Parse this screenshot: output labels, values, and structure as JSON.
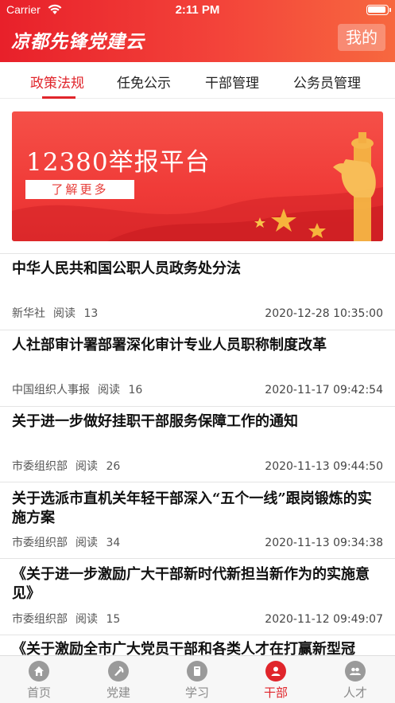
{
  "status_bar": {
    "carrier": "Carrier",
    "time": "2:11 PM"
  },
  "header": {
    "title": "凉都先锋党建云",
    "mine_label": "我的"
  },
  "tabs": [
    {
      "label": "政策法规",
      "active": true
    },
    {
      "label": "任免公示",
      "active": false
    },
    {
      "label": "干部管理",
      "active": false
    },
    {
      "label": "公务员管理",
      "active": false
    }
  ],
  "banner": {
    "title": "12380举报平台",
    "button_label": "了解更多"
  },
  "news": [
    {
      "title": "中华人民共和国公职人员政务处分法",
      "source": "新华社",
      "reads_label": "阅读",
      "reads": "13",
      "time": "2020-12-28 10:35:00"
    },
    {
      "title": "人社部审计署部署深化审计专业人员职称制度改革",
      "source": "中国组织人事报",
      "reads_label": "阅读",
      "reads": "16",
      "time": "2020-11-17 09:42:54"
    },
    {
      "title": "关于进一步做好挂职干部服务保障工作的通知",
      "source": "市委组织部",
      "reads_label": "阅读",
      "reads": "26",
      "time": "2020-11-13 09:44:50"
    },
    {
      "title": "关于选派市直机关年轻干部深入“五个一线”跟岗锻炼的实施方案",
      "source": "市委组织部",
      "reads_label": "阅读",
      "reads": "34",
      "time": "2020-11-13 09:34:38"
    },
    {
      "title": "《关于进一步激励广大干部新时代新担当新作为的实施意见》",
      "source": "市委组织部",
      "reads_label": "阅读",
      "reads": "15",
      "time": "2020-11-12 09:49:07"
    },
    {
      "title": "《关于激励全市广大党员干部和各类人才在打赢新型冠",
      "source": "",
      "reads_label": "",
      "reads": "",
      "time": ""
    }
  ],
  "bottom_tabs": [
    {
      "label": "首页",
      "icon": "home-icon",
      "active": false
    },
    {
      "label": "党建",
      "icon": "party-emblem-icon",
      "active": false
    },
    {
      "label": "学习",
      "icon": "book-icon",
      "active": false
    },
    {
      "label": "干部",
      "icon": "person-icon",
      "active": true
    },
    {
      "label": "人才",
      "icon": "group-icon",
      "active": false
    }
  ],
  "colors": {
    "brand_red": "#e0252b",
    "header_gradient_start": "#e8202a",
    "header_gradient_end": "#f7683f",
    "inactive_gray": "#8a8a8a"
  }
}
